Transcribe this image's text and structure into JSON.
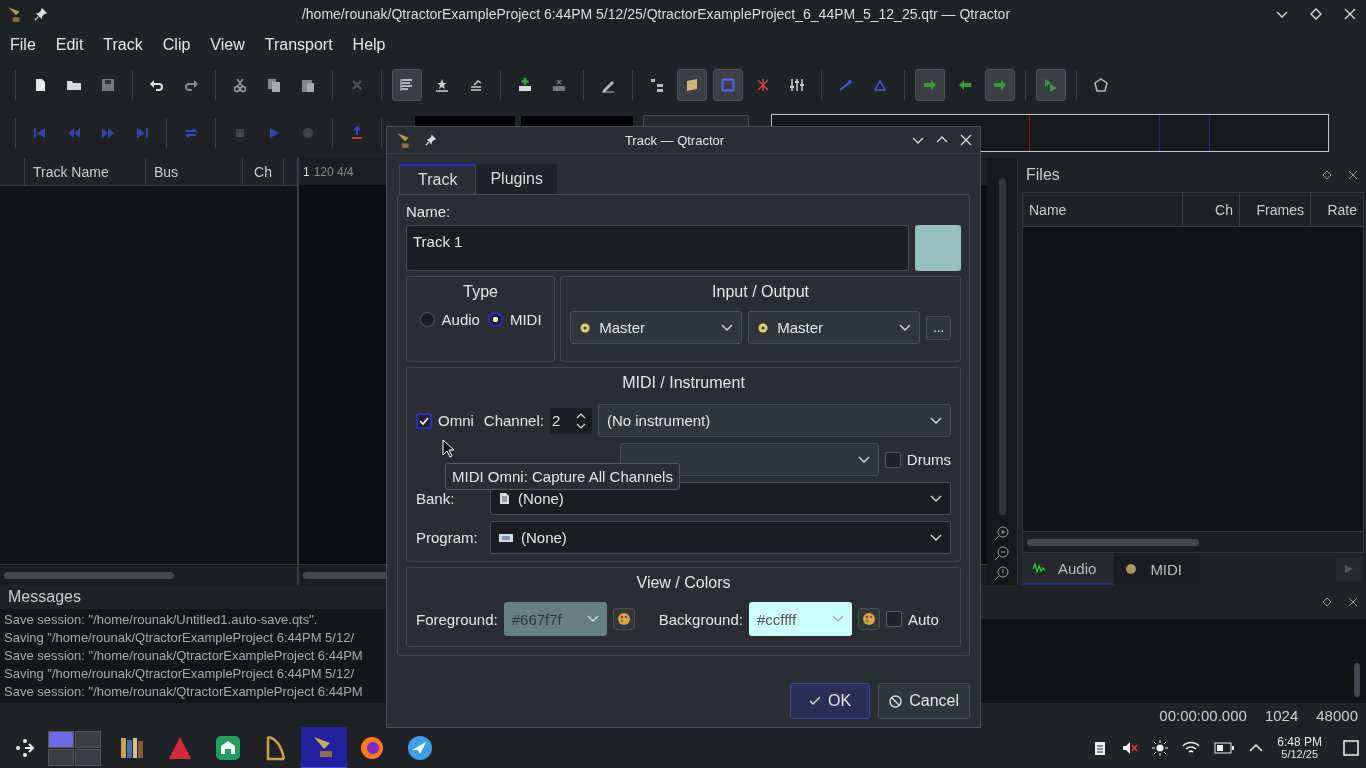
{
  "window": {
    "title": "/home/rounak/QtractorExampleProject 6:44PM 5/12/25/QtractorExampleProject_6_44PM_5_12_25.qtr — Qtractor"
  },
  "menu": [
    "File",
    "Edit",
    "Track",
    "Clip",
    "View",
    "Transport",
    "Help"
  ],
  "tracks": {
    "columns": [
      "Track Name",
      "Bus",
      "Ch"
    ]
  },
  "timeline": {
    "bar": "1",
    "tempo": "120 4/4"
  },
  "files": {
    "title": "Files",
    "columns": [
      "Name",
      "Ch",
      "Frames",
      "Rate"
    ],
    "tabs": [
      {
        "label": "Audio",
        "selected": true
      },
      {
        "label": "MIDI",
        "selected": false
      }
    ]
  },
  "messages": {
    "title": "Messages",
    "lines": [
      "Save session: \"/home/rounak/Untitled1.auto-save.qts\".",
      "Saving \"/home/rounak/QtractorExampleProject 6:44PM 5/12/",
      "Save session: \"/home/rounak/QtractorExampleProject 6:44PM",
      "Saving \"/home/rounak/QtractorExampleProject 6:44PM 5/12/",
      "Save session: \"/home/rounak/QtractorExampleProject 6:44PM"
    ]
  },
  "status_bar": [
    "00:00:00.000",
    "1024",
    "48000"
  ],
  "dialog": {
    "title": "Track — Qtractor",
    "tabs": [
      {
        "label": "Track",
        "selected": true
      },
      {
        "label": "Plugins",
        "selected": false
      }
    ],
    "name_label": "Name:",
    "name": "Track 1",
    "color": "#97bfbf",
    "type": {
      "title": "Type",
      "options": [
        {
          "label": "Audio",
          "selected": false
        },
        {
          "label": "MIDI",
          "selected": true
        }
      ]
    },
    "io": {
      "title": "Input / Output",
      "input": "Master",
      "output": "Master",
      "more": "..."
    },
    "midi": {
      "title": "MIDI / Instrument",
      "omni": {
        "label": "Omni",
        "checked": true
      },
      "channel_label": "Channel:",
      "channel": "2",
      "instrument": "(No instrument)",
      "drums": {
        "label": "Drums",
        "checked": false
      },
      "bank_label": "Bank:",
      "bank": "(None)",
      "program_label": "Program:",
      "program": "(None)"
    },
    "colors": {
      "title": "View / Colors",
      "foreground_label": "Foreground:",
      "foreground": "#667f7f",
      "background_label": "Background:",
      "background": "#ccffff",
      "auto": {
        "label": "Auto",
        "checked": false
      }
    },
    "buttons": [
      {
        "label": "OK",
        "kind": "default"
      },
      {
        "label": "Cancel",
        "kind": "cancel"
      }
    ],
    "tooltip": "MIDI Omni: Capture All Channels"
  },
  "taskbar": {
    "tasks": [
      {
        "selected": false
      },
      {
        "selected": false
      },
      {
        "selected": false
      },
      {
        "selected": false
      },
      {
        "selected": true
      },
      {
        "selected": false
      },
      {
        "selected": false
      }
    ],
    "time": "6:48 PM",
    "date": "5/12/25"
  }
}
